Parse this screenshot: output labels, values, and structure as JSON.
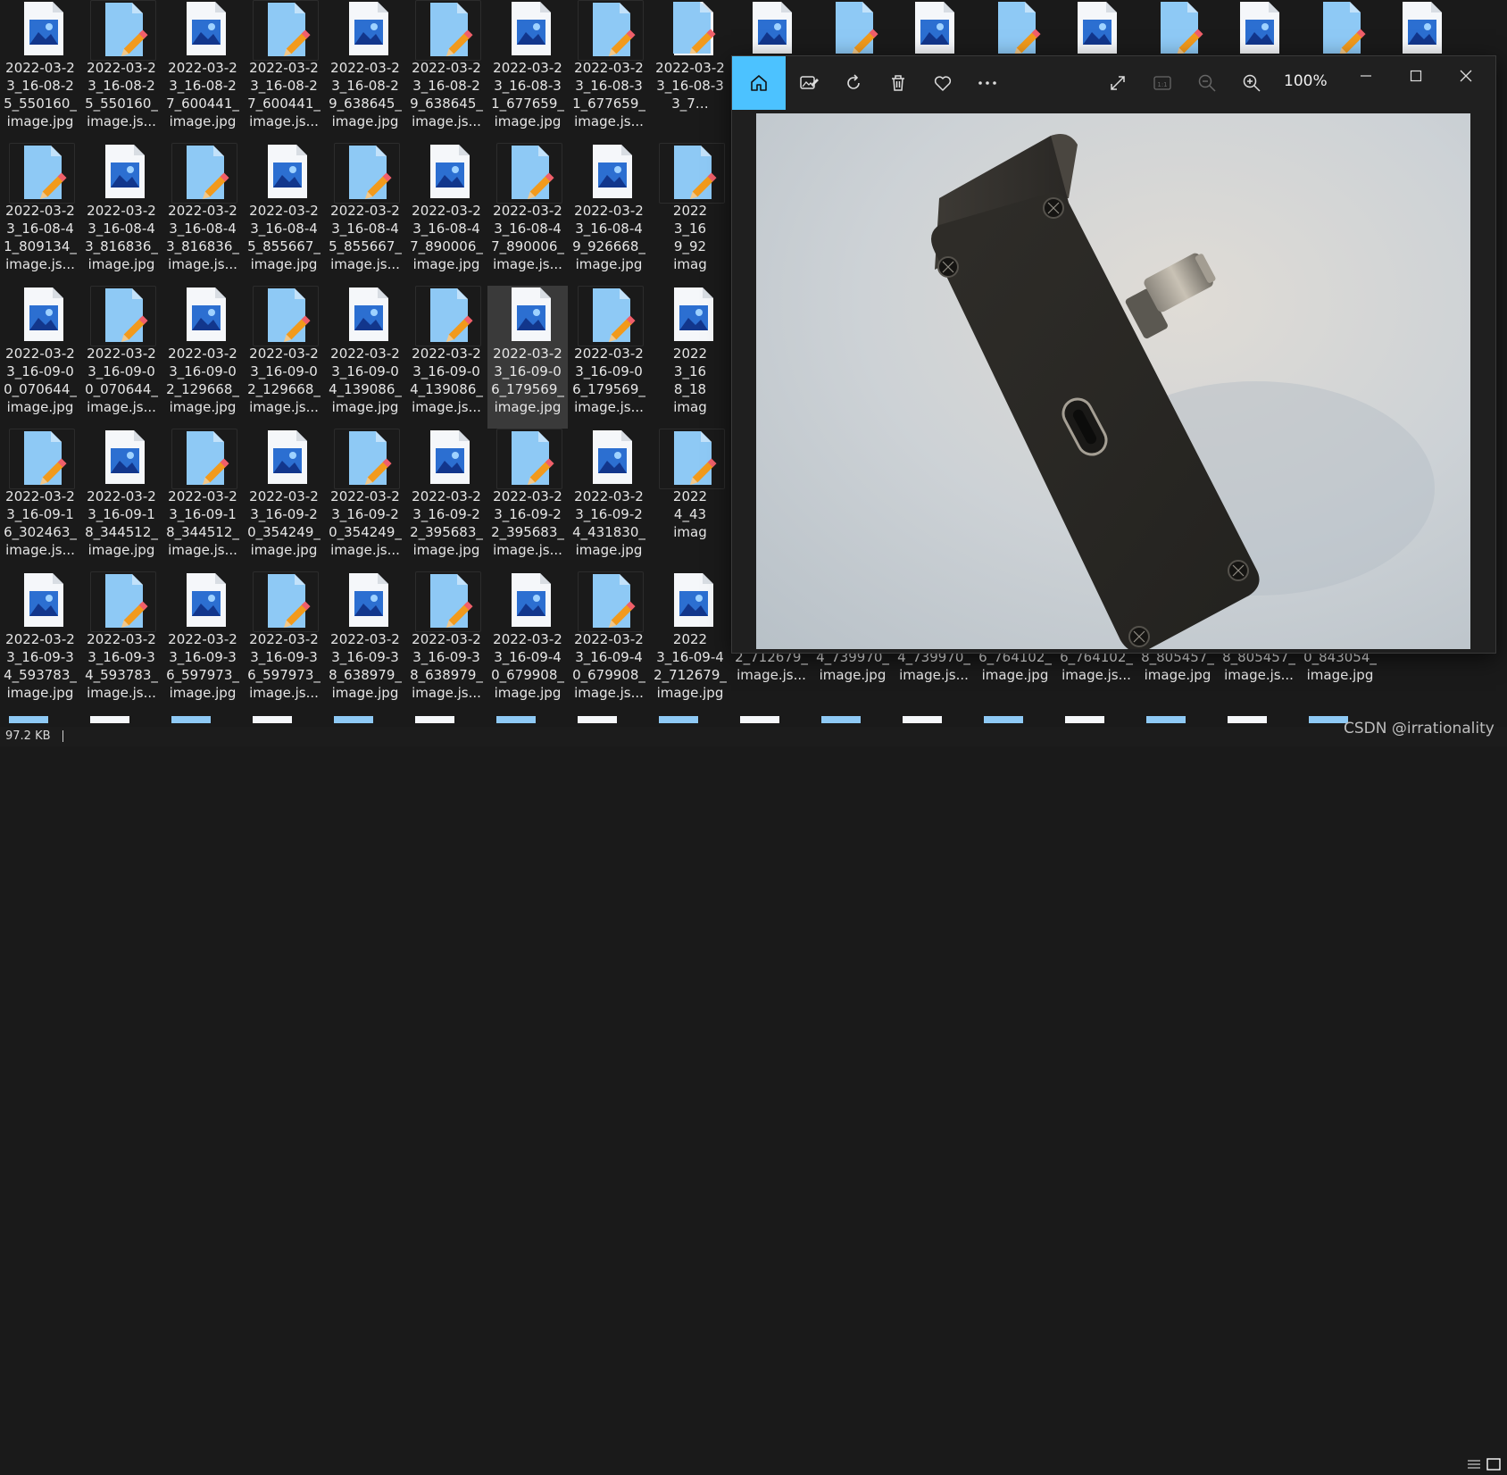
{
  "explorer": {
    "tiles": [
      {
        "type": "jpg",
        "name": "2022-03-2\n3_16-08-2\n5_550160_\nimage.jpg"
      },
      {
        "type": "js",
        "name": "2022-03-2\n3_16-08-2\n5_550160_\nimage.js..."
      },
      {
        "type": "jpg",
        "name": "2022-03-2\n3_16-08-2\n7_600441_\nimage.jpg"
      },
      {
        "type": "js",
        "name": "2022-03-2\n3_16-08-2\n7_600441_\nimage.js..."
      },
      {
        "type": "jpg",
        "name": "2022-03-2\n3_16-08-2\n9_638645_\nimage.jpg"
      },
      {
        "type": "js",
        "name": "2022-03-2\n3_16-08-2\n9_638645_\nimage.js..."
      },
      {
        "type": "jpg",
        "name": "2022-03-2\n3_16-08-3\n1_677659_\nimage.jpg"
      },
      {
        "type": "js",
        "name": "2022-03-2\n3_16-08-3\n1_677659_\nimage.js..."
      },
      {
        "type": "jpg",
        "name": "2022-03-2\n3_16-08-3\n3_7…"
      },
      {
        "type": "js",
        "name": "2022-03-2\n3_16-08-4\n1_809134_\nimage.js..."
      },
      {
        "type": "jpg",
        "name": "2022-03-2\n3_16-08-4\n3_816836_\nimage.jpg"
      },
      {
        "type": "js",
        "name": "2022-03-2\n3_16-08-4\n3_816836_\nimage.js..."
      },
      {
        "type": "jpg",
        "name": "2022-03-2\n3_16-08-4\n5_855667_\nimage.jpg"
      },
      {
        "type": "js",
        "name": "2022-03-2\n3_16-08-4\n5_855667_\nimage.js..."
      },
      {
        "type": "jpg",
        "name": "2022-03-2\n3_16-08-4\n7_890006_\nimage.jpg"
      },
      {
        "type": "js",
        "name": "2022-03-2\n3_16-08-4\n7_890006_\nimage.js..."
      },
      {
        "type": "jpg",
        "name": "2022-03-2\n3_16-08-4\n9_926668_\nimage.jpg"
      },
      {
        "type": "js",
        "name": "2022\n3_16\n9_92\nimag"
      },
      {
        "type": "jpg",
        "name": "2022-03-2\n3_16-09-0\n0_070644_\nimage.jpg"
      },
      {
        "type": "js",
        "name": "2022-03-2\n3_16-09-0\n0_070644_\nimage.js..."
      },
      {
        "type": "jpg",
        "name": "2022-03-2\n3_16-09-0\n2_129668_\nimage.jpg"
      },
      {
        "type": "js",
        "name": "2022-03-2\n3_16-09-0\n2_129668_\nimage.js..."
      },
      {
        "type": "jpg",
        "name": "2022-03-2\n3_16-09-0\n4_139086_\nimage.jpg"
      },
      {
        "type": "js",
        "name": "2022-03-2\n3_16-09-0\n4_139086_\nimage.js..."
      },
      {
        "type": "jpg",
        "name": "2022-03-2\n3_16-09-0\n6_179569_\nimage.jpg",
        "selected": true
      },
      {
        "type": "js",
        "name": "2022-03-2\n3_16-09-0\n6_179569_\nimage.js..."
      },
      {
        "type": "jpg",
        "name": "2022\n3_16\n8_18\nimag"
      },
      {
        "type": "js",
        "name": "2022-03-2\n3_16-09-1\n6_302463_\nimage.js..."
      },
      {
        "type": "jpg",
        "name": "2022-03-2\n3_16-09-1\n8_344512_\nimage.jpg"
      },
      {
        "type": "js",
        "name": "2022-03-2\n3_16-09-1\n8_344512_\nimage.js..."
      },
      {
        "type": "jpg",
        "name": "2022-03-2\n3_16-09-2\n0_354249_\nimage.jpg"
      },
      {
        "type": "js",
        "name": "2022-03-2\n3_16-09-2\n0_354249_\nimage.js..."
      },
      {
        "type": "jpg",
        "name": "2022-03-2\n3_16-09-2\n2_395683_\nimage.jpg"
      },
      {
        "type": "js",
        "name": "2022-03-2\n3_16-09-2\n2_395683_\nimage.js..."
      },
      {
        "type": "jpg",
        "name": "2022-03-2\n3_16-09-2\n4_431830_\nimage.jpg"
      },
      {
        "type": "js",
        "name": "2022\n4_43\nimag"
      },
      {
        "type": "jpg",
        "name": "2022-03-2\n3_16-09-3\n4_593783_\nimage.jpg"
      },
      {
        "type": "js",
        "name": "2022-03-2\n3_16-09-3\n4_593783_\nimage.js..."
      },
      {
        "type": "jpg",
        "name": "2022-03-2\n3_16-09-3\n6_597973_\nimage.jpg"
      },
      {
        "type": "js",
        "name": "2022-03-2\n3_16-09-3\n6_597973_\nimage.js..."
      },
      {
        "type": "jpg",
        "name": "2022-03-2\n3_16-09-3\n8_638979_\nimage.jpg"
      },
      {
        "type": "js",
        "name": "2022-03-2\n3_16-09-3\n8_638979_\nimage.js..."
      },
      {
        "type": "jpg",
        "name": "2022-03-2\n3_16-09-4\n0_679908_\nimage.jpg"
      },
      {
        "type": "js",
        "name": "2022-03-2\n3_16-09-4\n0_679908_\nimage.js..."
      },
      {
        "type": "jpg",
        "name": "2022\n3_16-09-4\n2_712679_\nimage.jpg"
      },
      {
        "type": "js",
        "name": "3_16-09-4\n2_712679_\nimage.js..."
      },
      {
        "type": "jpg",
        "name": "3_16-09-4\n4_739970_\nimage.jpg"
      },
      {
        "type": "js",
        "name": "3_16-09-4\n4_739970_\nimage.js..."
      },
      {
        "type": "jpg",
        "name": "3_16-09-4\n6_764102_\nimage.jpg"
      },
      {
        "type": "js",
        "name": "3_16-09-4\n6_764102_\nimage.js..."
      },
      {
        "type": "jpg",
        "name": "3_16-09-4\n8_805457_\nimage.jpg"
      },
      {
        "type": "js",
        "name": "3_16-09-4\n8_805457_\nimage.js..."
      },
      {
        "type": "jpg",
        "name": "3_16-09-5\n0_843054_\nimage.jpg"
      }
    ],
    "top_row_extra": [
      "js",
      "jpg",
      "js",
      "jpg",
      "js",
      "jpg",
      "js",
      "jpg",
      "js",
      "jpg"
    ]
  },
  "status": {
    "size": "97.2 KB"
  },
  "watermark": "CSDN @irrationality",
  "viewer": {
    "zoom": "100%",
    "toolbar_icons": [
      "home-icon",
      "edit-image-icon",
      "rotate-icon",
      "delete-icon",
      "favorite-icon",
      "more-icon",
      "fullscreen-icon",
      "actual-size-icon",
      "zoom-out-icon",
      "zoom-in-icon"
    ],
    "window_controls": [
      "minimize-icon",
      "maximize-icon",
      "close-icon"
    ],
    "colors": {
      "accent": "#4cc2ff",
      "device": "#2b2a27",
      "background": "#c9cfd4"
    }
  }
}
